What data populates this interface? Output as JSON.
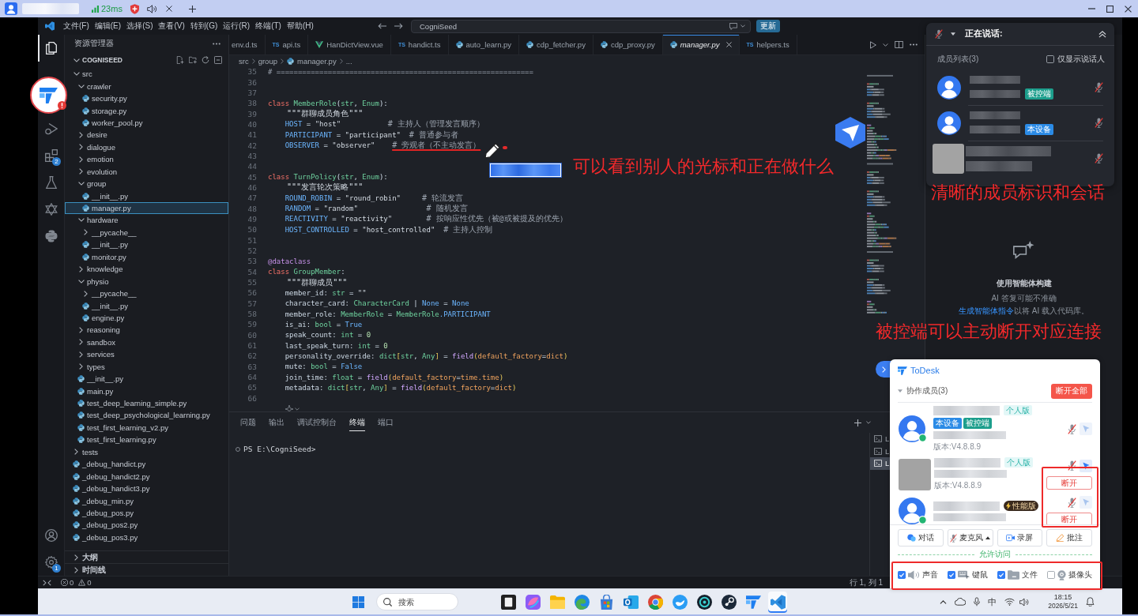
{
  "remote_bar": {
    "ping": "23ms"
  },
  "titlebar": {
    "menu": [
      "文件(F)",
      "编辑(E)",
      "选择(S)",
      "查看(V)",
      "转到(G)",
      "运行(R)",
      "终端(T)",
      "帮助(H)"
    ],
    "command_center": "CogniSeed",
    "update_button": "更新"
  },
  "activity_bar": {
    "top": [
      {
        "kind": "files",
        "selected": true
      },
      {
        "kind": "run",
        "selected": false
      },
      {
        "kind": "extensions",
        "selected": false,
        "badge": "2"
      },
      {
        "kind": "testing",
        "selected": false
      },
      {
        "kind": "triangles",
        "selected": false
      },
      {
        "kind": "python",
        "selected": false
      }
    ],
    "bottom": [
      {
        "kind": "account"
      },
      {
        "kind": "settings",
        "badge": "1"
      }
    ]
  },
  "sidebar": {
    "title": "资源管理器",
    "project": "COGNISEED",
    "tree": [
      {
        "name": "src",
        "kind": "folder",
        "expanded": true,
        "selected": false,
        "children": [
          {
            "name": "crawler",
            "kind": "folder",
            "expanded": true,
            "selected": false,
            "children": [
              {
                "name": "security.py",
                "kind": "file",
                "selected": false
              },
              {
                "name": "storage.py",
                "kind": "file",
                "selected": false
              },
              {
                "name": "worker_pool.py",
                "kind": "file",
                "selected": false
              }
            ]
          },
          {
            "name": "desire",
            "kind": "folder",
            "expanded": false,
            "selected": false
          },
          {
            "name": "dialogue",
            "kind": "folder",
            "expanded": false,
            "selected": false
          },
          {
            "name": "emotion",
            "kind": "folder",
            "expanded": false,
            "selected": false
          },
          {
            "name": "evolution",
            "kind": "folder",
            "expanded": false,
            "selected": false
          },
          {
            "name": "group",
            "kind": "folder",
            "expanded": true,
            "selected": false,
            "children": [
              {
                "name": "__init__.py",
                "kind": "file",
                "selected": false
              },
              {
                "name": "manager.py",
                "kind": "file",
                "selected": true
              }
            ]
          },
          {
            "name": "hardware",
            "kind": "folder",
            "expanded": true,
            "selected": false,
            "children": [
              {
                "name": "__pycache__",
                "kind": "folder",
                "expanded": false,
                "selected": false
              },
              {
                "name": "__init__.py",
                "kind": "file",
                "selected": false
              },
              {
                "name": "monitor.py",
                "kind": "file",
                "selected": false
              }
            ]
          },
          {
            "name": "knowledge",
            "kind": "folder",
            "expanded": false,
            "selected": false
          },
          {
            "name": "physio",
            "kind": "folder",
            "expanded": true,
            "selected": false,
            "children": [
              {
                "name": "__pycache__",
                "kind": "folder",
                "expanded": false,
                "selected": false
              },
              {
                "name": "__init__.py",
                "kind": "file",
                "selected": false
              },
              {
                "name": "engine.py",
                "kind": "file",
                "selected": false
              }
            ]
          },
          {
            "name": "reasoning",
            "kind": "folder",
            "expanded": false,
            "selected": false
          },
          {
            "name": "sandbox",
            "kind": "folder",
            "expanded": false,
            "selected": false
          },
          {
            "name": "services",
            "kind": "folder",
            "expanded": false,
            "selected": false
          },
          {
            "name": "types",
            "kind": "folder",
            "expanded": false,
            "selected": false
          },
          {
            "name": "__init__.py",
            "kind": "file",
            "selected": false
          },
          {
            "name": "main.py",
            "kind": "file",
            "selected": false
          },
          {
            "name": "test_deep_learning_simple.py",
            "kind": "file",
            "selected": false
          },
          {
            "name": "test_deep_psychological_learning.py",
            "kind": "file",
            "selected": false
          },
          {
            "name": "test_first_learning_v2.py",
            "kind": "file",
            "selected": false
          },
          {
            "name": "test_first_learning.py",
            "kind": "file",
            "selected": false
          }
        ]
      },
      {
        "name": "tests",
        "kind": "folder",
        "expanded": false,
        "selected": false
      },
      {
        "name": "_debug_handict.py",
        "kind": "file",
        "selected": false
      },
      {
        "name": "_debug_handict2.py",
        "kind": "file",
        "selected": false
      },
      {
        "name": "_debug_handict3.py",
        "kind": "file",
        "selected": false
      },
      {
        "name": "_debug_min.py",
        "kind": "file",
        "selected": false
      },
      {
        "name": "_debug_pos.py",
        "kind": "file",
        "selected": false
      },
      {
        "name": "_debug_pos2.py",
        "kind": "file",
        "selected": false
      },
      {
        "name": "_debug_pos3.py",
        "kind": "file",
        "selected": false
      }
    ],
    "sections": [
      {
        "label": "大纲",
        "expanded": false
      },
      {
        "label": "时间线",
        "expanded": false
      }
    ]
  },
  "tabs": [
    {
      "label": "env.d.ts",
      "kind": "none",
      "selected": false
    },
    {
      "label": "api.ts",
      "kind": "ts",
      "icon_text": "TS",
      "selected": false
    },
    {
      "label": "HanDictView.vue",
      "kind": "vue",
      "selected": false
    },
    {
      "label": "handict.ts",
      "kind": "ts",
      "icon_text": "TS",
      "selected": false
    },
    {
      "label": "auto_learn.py",
      "kind": "py",
      "selected": false
    },
    {
      "label": "cdp_fetcher.py",
      "kind": "py",
      "selected": false
    },
    {
      "label": "cdp_proxy.py",
      "kind": "py",
      "selected": false
    },
    {
      "label": "manager.py",
      "kind": "py",
      "selected": true
    },
    {
      "label": "helpers.ts",
      "kind": "ts",
      "icon_text": "TS",
      "selected": false
    }
  ],
  "breadcrumb": [
    {
      "label": "src",
      "kind": "folder"
    },
    {
      "label": "group",
      "kind": "folder"
    },
    {
      "label": "manager.py",
      "kind": "py"
    },
    {
      "label": "...",
      "kind": "symbol"
    }
  ],
  "code": {
    "lines": [
      {
        "n": "35",
        "t": [
          {
            "text": "# ============================================================",
            "kind": "rule"
          }
        ]
      },
      {
        "n": "36"
      },
      {
        "n": "37"
      },
      {
        "n": "38",
        "t": [
          {
            "text": "class ",
            "kind": "keyword"
          },
          {
            "text": "MemberRole",
            "kind": "class"
          },
          {
            "text": "(",
            "kind": "plain"
          },
          {
            "text": "str",
            "kind": "class"
          },
          {
            "text": ", ",
            "kind": "plain"
          },
          {
            "text": "Enum",
            "kind": "class"
          },
          {
            "text": "):",
            "kind": "plain"
          }
        ]
      },
      {
        "n": "39",
        "t": [
          {
            "text": "    \"\"\"群聊成员角色\"\"\"",
            "kind": "docstring"
          }
        ]
      },
      {
        "n": "40",
        "t": [
          {
            "text": "    HOST",
            "kind": "constant"
          },
          {
            "text": " = ",
            "kind": "plain"
          },
          {
            "text": "\"host\"           ",
            "kind": "string"
          },
          {
            "text": "# 主持人（管理发言顺序）",
            "kind": "comment"
          }
        ]
      },
      {
        "n": "41",
        "t": [
          {
            "text": "    PARTICIPANT",
            "kind": "constant"
          },
          {
            "text": " = ",
            "kind": "plain"
          },
          {
            "text": "\"participant\"  ",
            "kind": "string"
          },
          {
            "text": "# 普通参与者",
            "kind": "comment"
          }
        ]
      },
      {
        "n": "42",
        "t": [
          {
            "text": "    OBSERVER",
            "kind": "constant"
          },
          {
            "text": " = ",
            "kind": "plain"
          },
          {
            "text": "\"observer\"    ",
            "kind": "string"
          },
          {
            "text": "# 旁观者（不主动发言）",
            "kind": "marked"
          }
        ]
      },
      {
        "n": "43"
      },
      {
        "n": "44"
      },
      {
        "n": "45",
        "t": [
          {
            "text": "class ",
            "kind": "keyword"
          },
          {
            "text": "TurnPolicy",
            "kind": "class"
          },
          {
            "text": "(",
            "kind": "plain"
          },
          {
            "text": "str",
            "kind": "class"
          },
          {
            "text": ", ",
            "kind": "plain"
          },
          {
            "text": "Enum",
            "kind": "class"
          },
          {
            "text": "):",
            "kind": "plain"
          }
        ]
      },
      {
        "n": "46",
        "t": [
          {
            "text": "    \"\"\"发言轮次策略\"\"\"",
            "kind": "docstring"
          }
        ]
      },
      {
        "n": "47",
        "t": [
          {
            "text": "    ROUND_ROBIN",
            "kind": "constant"
          },
          {
            "text": " = ",
            "kind": "plain"
          },
          {
            "text": "\"round_robin\"     ",
            "kind": "string"
          },
          {
            "text": "# 轮流发言",
            "kind": "comment"
          }
        ]
      },
      {
        "n": "48",
        "t": [
          {
            "text": "    RANDOM",
            "kind": "constant"
          },
          {
            "text": " = ",
            "kind": "plain"
          },
          {
            "text": "\"random\"                ",
            "kind": "string"
          },
          {
            "text": "# 随机发言",
            "kind": "comment"
          }
        ]
      },
      {
        "n": "49",
        "t": [
          {
            "text": "    REACTIVITY",
            "kind": "constant"
          },
          {
            "text": " = ",
            "kind": "plain"
          },
          {
            "text": "\"reactivity\"        ",
            "kind": "string"
          },
          {
            "text": "# 按响应性优先（被@或被提及的优先）",
            "kind": "comment"
          }
        ]
      },
      {
        "n": "50",
        "t": [
          {
            "text": "    HOST_CONTROLLED",
            "kind": "constant"
          },
          {
            "text": " = ",
            "kind": "plain"
          },
          {
            "text": "\"host_controlled\"  ",
            "kind": "string"
          },
          {
            "text": "# 主持人控制",
            "kind": "comment"
          }
        ]
      },
      {
        "n": "51"
      },
      {
        "n": "52"
      },
      {
        "n": "53",
        "t": [
          {
            "text": "@dataclass",
            "kind": "decorator"
          }
        ]
      },
      {
        "n": "54",
        "t": [
          {
            "text": "class ",
            "kind": "keyword"
          },
          {
            "text": "GroupMember",
            "kind": "class"
          },
          {
            "text": ":",
            "kind": "plain"
          }
        ]
      },
      {
        "n": "55",
        "t": [
          {
            "text": "    \"\"\"群聊成员\"\"\"",
            "kind": "docstring"
          }
        ]
      },
      {
        "n": "56",
        "t": [
          {
            "text": "    member_id: ",
            "kind": "plain"
          },
          {
            "text": "str",
            "kind": "type"
          },
          {
            "text": " = ",
            "kind": "plain"
          },
          {
            "text": "\"\"",
            "kind": "string"
          }
        ]
      },
      {
        "n": "57",
        "t": [
          {
            "text": "    character_card: ",
            "kind": "plain"
          },
          {
            "text": "CharacterCard",
            "kind": "class"
          },
          {
            "text": " | ",
            "kind": "plain"
          },
          {
            "text": "None",
            "kind": "builtin"
          },
          {
            "text": " = ",
            "kind": "plain"
          },
          {
            "text": "None",
            "kind": "builtin"
          }
        ]
      },
      {
        "n": "58",
        "t": [
          {
            "text": "    member_role: ",
            "kind": "plain"
          },
          {
            "text": "MemberRole",
            "kind": "class"
          },
          {
            "text": " = ",
            "kind": "plain"
          },
          {
            "text": "MemberRole",
            "kind": "class"
          },
          {
            "text": ".PARTICIPANT",
            "kind": "constant"
          }
        ]
      },
      {
        "n": "59",
        "t": [
          {
            "text": "    is_ai: ",
            "kind": "plain"
          },
          {
            "text": "bool",
            "kind": "type"
          },
          {
            "text": " = ",
            "kind": "plain"
          },
          {
            "text": "True",
            "kind": "builtin"
          }
        ]
      },
      {
        "n": "60",
        "t": [
          {
            "text": "    speak_count: ",
            "kind": "plain"
          },
          {
            "text": "int",
            "kind": "type"
          },
          {
            "text": " = ",
            "kind": "plain"
          },
          {
            "text": "0",
            "kind": "number"
          }
        ]
      },
      {
        "n": "61",
        "t": [
          {
            "text": "    last_speak_turn: ",
            "kind": "plain"
          },
          {
            "text": "int",
            "kind": "type"
          },
          {
            "text": " = ",
            "kind": "plain"
          },
          {
            "text": "0",
            "kind": "number"
          }
        ]
      },
      {
        "n": "62",
        "t": [
          {
            "text": "    personality_override: ",
            "kind": "plain"
          },
          {
            "text": "dict",
            "kind": "type"
          },
          {
            "text": "[",
            "kind": "bracket"
          },
          {
            "text": "str",
            "kind": "type"
          },
          {
            "text": ", ",
            "kind": "plain"
          },
          {
            "text": "Any",
            "kind": "type"
          },
          {
            "text": "]",
            "kind": "bracket"
          },
          {
            "text": " = ",
            "kind": "plain"
          },
          {
            "text": "field",
            "kind": "function"
          },
          {
            "text": "(",
            "kind": "bracket"
          },
          {
            "text": "default_factory",
            "kind": "argument"
          },
          {
            "text": "=",
            "kind": "plain"
          },
          {
            "text": "dict",
            "kind": "argument"
          },
          {
            "text": ")",
            "kind": "bracket"
          }
        ]
      },
      {
        "n": "63",
        "t": [
          {
            "text": "    mute: ",
            "kind": "plain"
          },
          {
            "text": "bool",
            "kind": "type"
          },
          {
            "text": " = ",
            "kind": "plain"
          },
          {
            "text": "False",
            "kind": "builtin"
          }
        ]
      },
      {
        "n": "64",
        "t": [
          {
            "text": "    join_time: ",
            "kind": "plain"
          },
          {
            "text": "float",
            "kind": "type"
          },
          {
            "text": " = ",
            "kind": "plain"
          },
          {
            "text": "field",
            "kind": "function"
          },
          {
            "text": "(",
            "kind": "bracket"
          },
          {
            "text": "default_factory",
            "kind": "argument"
          },
          {
            "text": "=",
            "kind": "plain"
          },
          {
            "text": "time.time",
            "kind": "argument"
          },
          {
            "text": ")",
            "kind": "bracket"
          }
        ]
      },
      {
        "n": "65",
        "t": [
          {
            "text": "    metadata: ",
            "kind": "plain"
          },
          {
            "text": "dict",
            "kind": "type"
          },
          {
            "text": "[",
            "kind": "bracket"
          },
          {
            "text": "str",
            "kind": "type"
          },
          {
            "text": ", ",
            "kind": "plain"
          },
          {
            "text": "Any",
            "kind": "type"
          },
          {
            "text": "]",
            "kind": "bracket"
          },
          {
            "text": " = ",
            "kind": "plain"
          },
          {
            "text": "field",
            "kind": "function"
          },
          {
            "text": "(",
            "kind": "bracket"
          },
          {
            "text": "default_factory",
            "kind": "argument"
          },
          {
            "text": "=",
            "kind": "plain"
          },
          {
            "text": "dict",
            "kind": "argument"
          },
          {
            "text": ")",
            "kind": "bracket"
          }
        ]
      },
      {
        "n": "66"
      }
    ]
  },
  "terminal": {
    "tabs": [
      {
        "label": "问题",
        "selected": false
      },
      {
        "label": "输出",
        "selected": false
      },
      {
        "label": "调试控制台",
        "selected": false
      },
      {
        "label": "终端",
        "selected": true
      },
      {
        "label": "端口",
        "selected": false
      }
    ],
    "prompt": "PS E:\\CogniSeed>",
    "sessions": [
      {
        "label": "L",
        "selected": false
      },
      {
        "label": "L",
        "selected": false
      },
      {
        "label": "L",
        "selected": true
      }
    ]
  },
  "status_bar": {
    "errors": "0",
    "warnings": "0",
    "cursor": "行 1, 列 1"
  },
  "chat_panel": {
    "title": "使用智能体构建",
    "note": "AI 答复可能不准确",
    "link": "生成智能体指令",
    "hint": "以将 AI 载入代码库。"
  },
  "voice_panel": {
    "muted": true,
    "title": "正在说话:",
    "list_label": "成员列表(3)",
    "speakers_only": {
      "label": "仅显示说话人",
      "checked": false
    },
    "members": [
      {
        "kind": "avatar",
        "tag": {
          "label": "被控端",
          "color": "#1c9e8c"
        },
        "muted": true
      },
      {
        "kind": "avatar",
        "tag": {
          "label": "本设备",
          "color": "#2b8be6"
        },
        "muted": true
      },
      {
        "kind": "photo",
        "muted": true
      }
    ]
  },
  "annotations": {
    "cursor": "可以看到别人的光标和正在做什么",
    "members": "清晰的成员标识和会话",
    "disconnect": "被控端可以主动断开对应连接"
  },
  "todesk": {
    "brand": "ToDesk",
    "group_label": "协作成员(3)",
    "group_expanded": true,
    "disconnect_all": "断开全部",
    "members": [
      {
        "kind": "avatar",
        "online": true,
        "edition": {
          "label": "个人版",
          "kind": "personal"
        },
        "tags": [
          {
            "label": "本设备",
            "color": "#2b8be6"
          },
          {
            "label": "被控端",
            "color": "#1c9e8c"
          }
        ],
        "version": "版本:V4.8.8.9",
        "muted": true,
        "pointer_active": false
      },
      {
        "kind": "photo",
        "edition": {
          "label": "个人版",
          "kind": "personal"
        },
        "version": "版本:V4.8.8.9",
        "muted": true,
        "pointer_active": true,
        "disconnect": "断开"
      },
      {
        "kind": "avatar",
        "online": true,
        "edition": {
          "label": "性能版",
          "kind": "performance"
        },
        "muted": true,
        "pointer_active": false,
        "disconnect": "断开"
      }
    ],
    "actions": [
      {
        "kind": "chat",
        "label": "对话"
      },
      {
        "kind": "mic",
        "label": "麦克风",
        "muted": true
      },
      {
        "kind": "record",
        "label": "录屏"
      },
      {
        "kind": "annotate",
        "label": "批注"
      }
    ],
    "access_label": "允许访问",
    "access": [
      {
        "kind": "sound",
        "label": "声音",
        "checked": true
      },
      {
        "kind": "input",
        "label": "键鼠",
        "checked": true
      },
      {
        "kind": "files",
        "label": "文件",
        "checked": true
      },
      {
        "kind": "camera",
        "label": "摄像头",
        "checked": false
      }
    ]
  },
  "taskbar": {
    "search": {
      "placeholder": "搜索"
    },
    "apps": [
      {
        "kind": "tile",
        "selected": false
      },
      {
        "kind": "gradient",
        "selected": false
      },
      {
        "kind": "folder",
        "selected": false
      },
      {
        "kind": "swirl",
        "selected": false
      },
      {
        "kind": "bag",
        "selected": false
      },
      {
        "kind": "mail",
        "selected": false
      },
      {
        "kind": "segments",
        "selected": false
      },
      {
        "kind": "wave",
        "selected": false
      },
      {
        "kind": "ring",
        "selected": false
      },
      {
        "kind": "knob",
        "selected": false
      },
      {
        "kind": "remote",
        "selected": false
      },
      {
        "kind": "editor",
        "selected": true
      }
    ],
    "tray": {
      "ime": "中",
      "time": "18:15",
      "date": "2026/5/21"
    }
  }
}
